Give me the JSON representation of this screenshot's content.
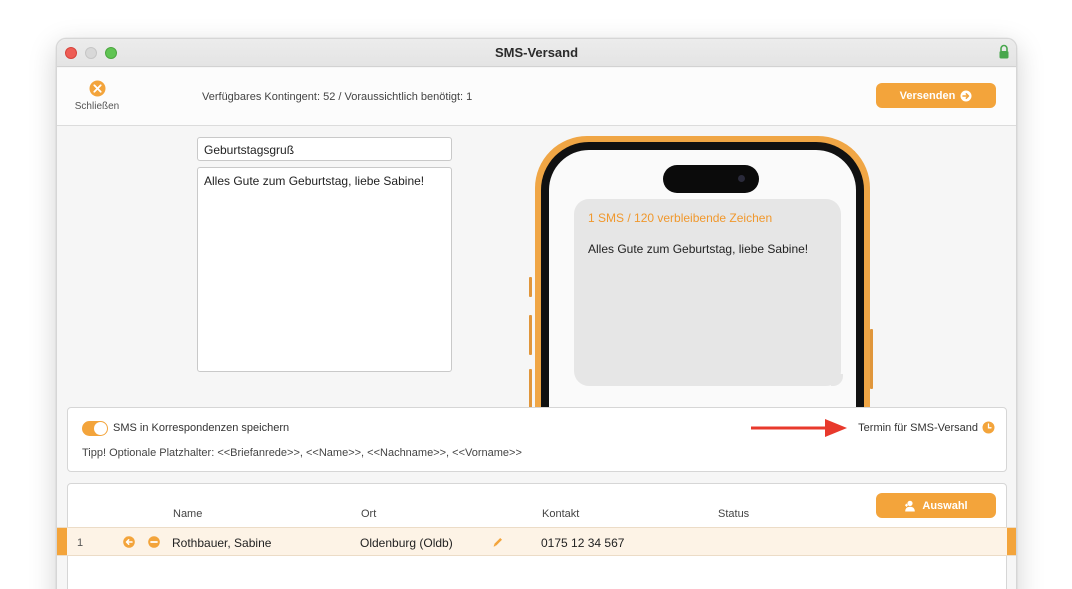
{
  "window": {
    "title": "SMS-Versand"
  },
  "toolbar": {
    "close_label": "Schließen",
    "quota_text": "Verfügbares Kontingent: 52 / Voraussichtlich benötigt: 1",
    "send_label": "Versenden"
  },
  "editor": {
    "subject": "Geburtstagsgruß",
    "body": "Alles Gute zum Geburtstag, liebe Sabine!"
  },
  "preview": {
    "counter": "1 SMS / 120 verbleibende Zeichen",
    "message": "Alles Gute zum Geburtstag, liebe Sabine!"
  },
  "options": {
    "save_toggle_label": "SMS in Korrespondenzen speichern",
    "save_toggle_on": true,
    "hint": "Tipp! Optionale Platzhalter: <<Briefanrede>>, <<Name>>, <<Nachname>>, <<Vorname>>",
    "schedule_label": "Termin für SMS-Versand"
  },
  "recipients": {
    "columns": {
      "name": "Name",
      "ort": "Ort",
      "kontakt": "Kontakt",
      "status": "Status"
    },
    "select_label": "Auswahl",
    "rows": [
      {
        "index": "1",
        "name": "Rothbauer, Sabine",
        "ort": "Oldenburg (Oldb)",
        "kontakt": "0175 12 34 567",
        "status": ""
      }
    ]
  },
  "colors": {
    "accent": "#f3a43b",
    "annotation_arrow": "#e8392c"
  },
  "icons": {
    "close": "close-circle-icon",
    "send": "arrow-right-circle-icon",
    "lock": "lock-icon",
    "clock": "clock-icon",
    "select": "person-plus-icon",
    "row_back": "arrow-left-circle-icon",
    "row_remove": "minus-circle-icon",
    "row_edit": "pencil-icon"
  }
}
